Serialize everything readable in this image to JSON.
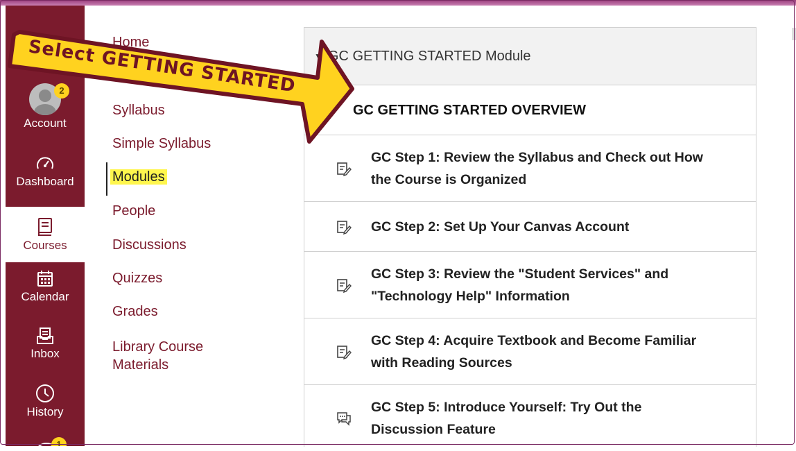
{
  "global_nav": {
    "account": {
      "label": "Account",
      "badge": "2"
    },
    "dashboard": {
      "label": "Dashboard"
    },
    "courses": {
      "label": "Courses"
    },
    "calendar": {
      "label": "Calendar"
    },
    "inbox": {
      "label": "Inbox"
    },
    "history": {
      "label": "History"
    },
    "partial_badge": "1"
  },
  "course_nav": {
    "items": [
      {
        "label": "Home"
      },
      {
        "label": "Syllabus"
      },
      {
        "label": "Simple Syllabus"
      },
      {
        "label": "Modules"
      },
      {
        "label": "People"
      },
      {
        "label": "Discussions"
      },
      {
        "label": "Quizzes"
      },
      {
        "label": "Grades"
      },
      {
        "label": "Library Course Materials"
      }
    ],
    "active": "Modules"
  },
  "module": {
    "title": "GC GETTING STARTED Module",
    "items": [
      {
        "label": "GC GETTING STARTED OVERVIEW",
        "type": "subheader"
      },
      {
        "label": "GC Step 1: Review the Syllabus and Check out How the Course is Organized",
        "icon": "assignment-icon"
      },
      {
        "label": "GC Step 2: Set Up Your Canvas Account",
        "icon": "assignment-icon"
      },
      {
        "label": "GC Step 3: Review the \"Student Services\" and \"Technology Help\" Information",
        "icon": "assignment-icon"
      },
      {
        "label": "GC Step 4: Acquire Textbook and Become Familiar with Reading Sources",
        "icon": "assignment-icon"
      },
      {
        "label": "GC Step 5: Introduce Yourself: Try Out the Discussion Feature",
        "icon": "discussion-icon"
      }
    ]
  },
  "annotation": {
    "text": "Select GETTING STARTED",
    "fill": "#ffd21f",
    "outline": "#6e1424"
  },
  "colors": {
    "nav_bg": "#7b1b2d",
    "link": "#7b1b2d",
    "highlight": "#fff64d"
  }
}
